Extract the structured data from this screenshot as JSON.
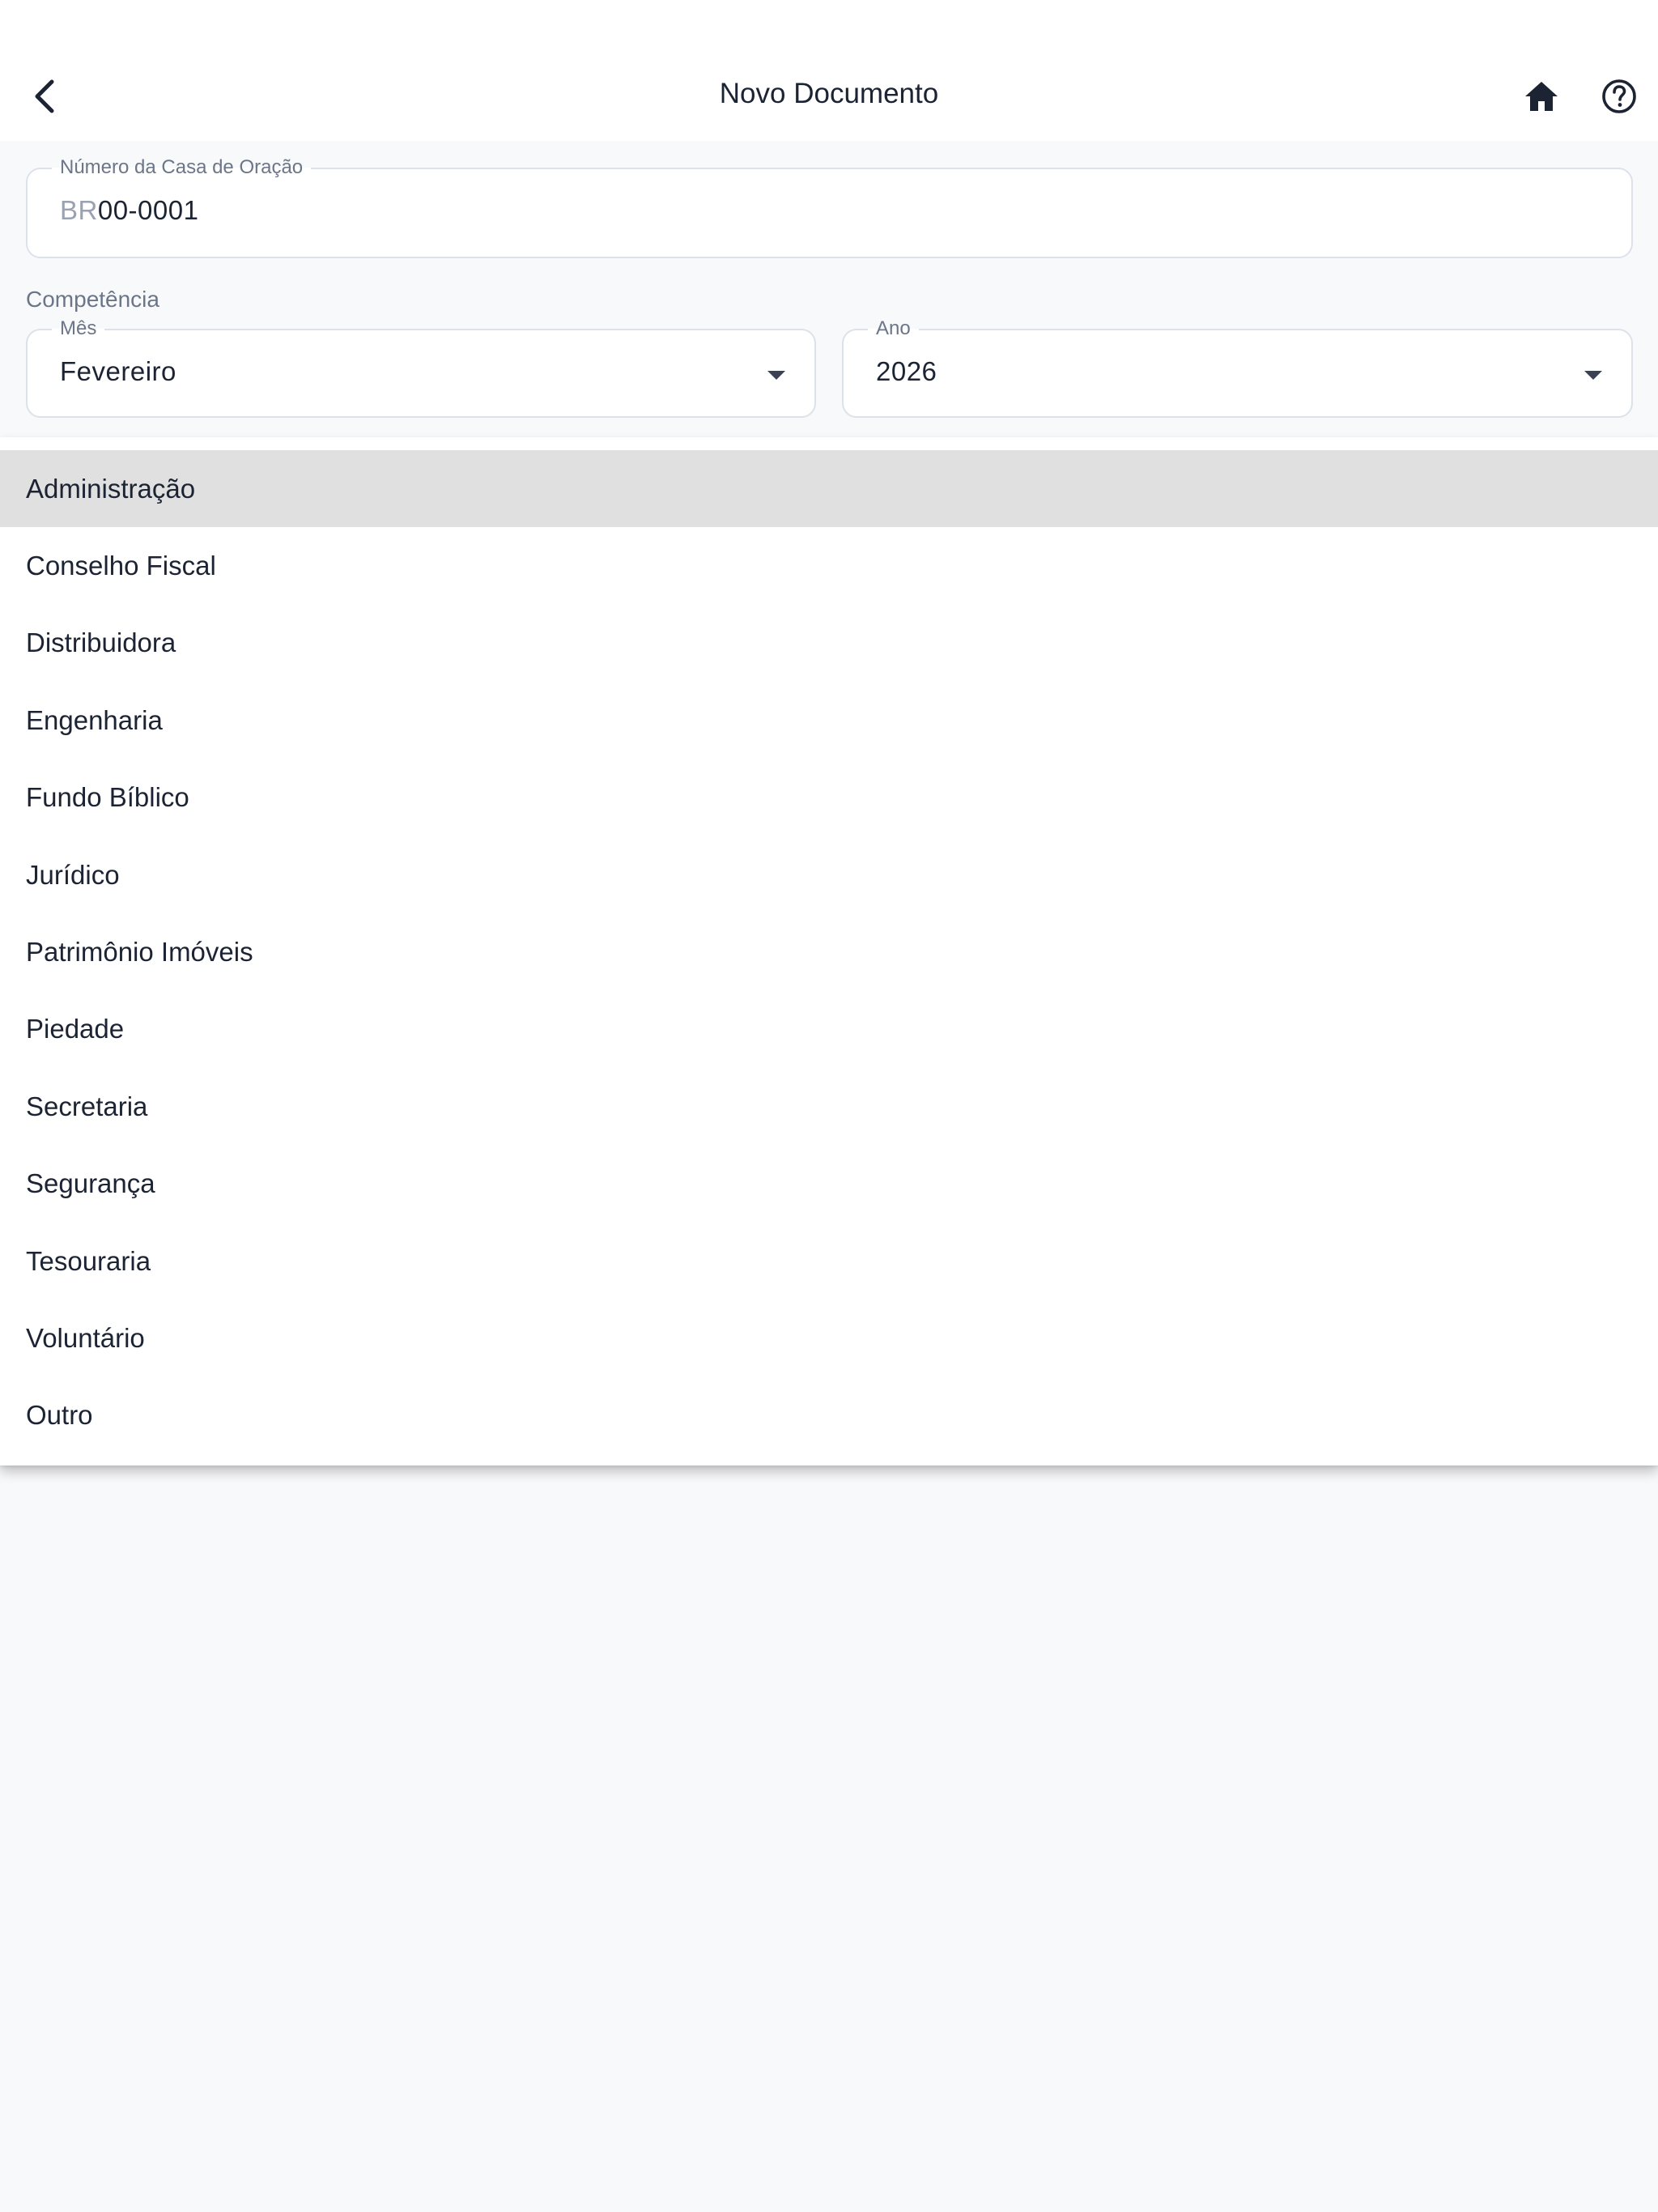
{
  "header": {
    "title": "Novo Documento",
    "back_icon": "chevron-left-icon",
    "home_icon": "home-icon",
    "help_icon": "help-circle-icon"
  },
  "form": {
    "numero": {
      "label": "Número da Casa de Oração",
      "prefix": "BR",
      "value": "00-0001"
    },
    "competencia_label": "Competência",
    "mes": {
      "label": "Mês",
      "value": "Fevereiro"
    },
    "ano": {
      "label": "Ano",
      "value": "2026"
    }
  },
  "dropdown": {
    "highlighted_index": 0,
    "items": [
      "Administração",
      "Conselho Fiscal",
      "Distribuidora",
      "Engenharia",
      "Fundo Bíblico",
      "Jurídico",
      "Patrimônio Imóveis",
      "Piedade",
      "Secretaria",
      "Segurança",
      "Tesouraria",
      "Voluntário",
      "Outro"
    ]
  },
  "colors": {
    "page_background": "#f8f9fb",
    "text": "#1c2434",
    "label": "#6b7688",
    "prefix": "#98a2b3",
    "border": "#dde2ea",
    "highlight": "#e0e0e0"
  }
}
